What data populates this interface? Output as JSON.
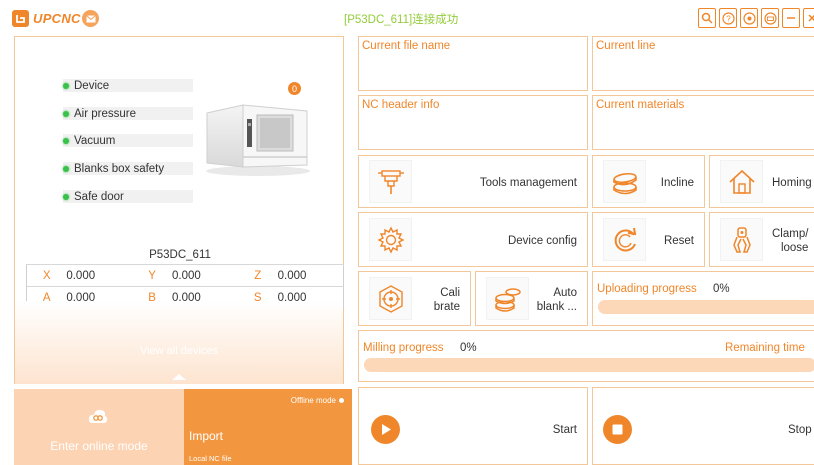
{
  "header": {
    "brand": "UPCNC",
    "connection_status": "[P53DC_611]连接成功",
    "tool_icons": [
      "search-icon",
      "help-icon",
      "settings-badge-icon",
      "keyboard-icon",
      "minimize-icon",
      "close-icon"
    ]
  },
  "device_panel": {
    "statuses": [
      {
        "label": "Device",
        "state": "green"
      },
      {
        "label": "Air pressure",
        "state": "green"
      },
      {
        "label": "Vacuum",
        "state": "green"
      },
      {
        "label": "Blanks box safety",
        "state": "green"
      },
      {
        "label": "Safe door",
        "state": "green"
      }
    ],
    "badge_count": "0",
    "machine_name": "P53DC_611",
    "coords": {
      "x_label": "X",
      "x": "0.000",
      "y_label": "Y",
      "y": "0.000",
      "z_label": "Z",
      "z": "0.000",
      "a_label": "A",
      "a": "0.000",
      "b_label": "B",
      "b": "0.000",
      "s_label": "S",
      "s": "0.000"
    },
    "view_all": "View all devices"
  },
  "mode": {
    "online_label": "Enter online mode",
    "offline_label": "Offline mode",
    "import_label": "Import",
    "import_sub": "Local NC file"
  },
  "info": {
    "current_file": "Current file name",
    "current_line": "Current line",
    "nc_header": "NC header info",
    "current_materials": "Current materials"
  },
  "actions": {
    "tools_management": "Tools management",
    "incline": "Incline",
    "homing": "Homing",
    "device_config": "Device config",
    "reset": "Reset",
    "clamp_line1": "Clamp/",
    "clamp_line2": "loose",
    "calibrate_line1": "Cali",
    "calibrate_line2": "brate",
    "auto_blank_line1": "Auto",
    "auto_blank_line2": "blank ..."
  },
  "progress": {
    "uploading_label": "Uploading progress",
    "uploading_value": "0%",
    "milling_label": "Milling progress",
    "milling_value": "0%",
    "remaining_label": "Remaining time"
  },
  "controls": {
    "start": "Start",
    "stop": "Stop"
  },
  "colors": {
    "accent": "#f0862a",
    "border": "#f4c79a",
    "status_ok": "#39c14a",
    "connected_text": "#93cc3a"
  }
}
